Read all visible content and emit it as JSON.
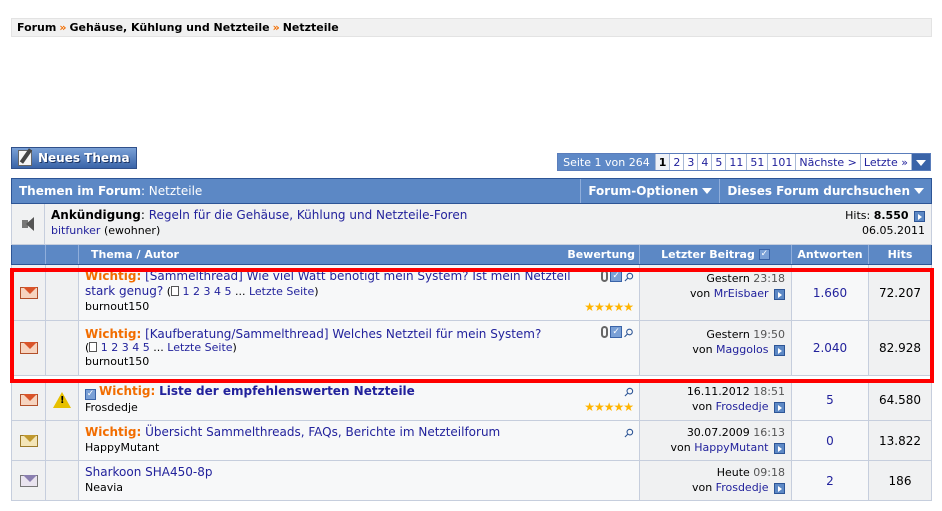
{
  "breadcrumb": {
    "items": [
      "Forum",
      "Gehäuse, Kühlung und Netzteile",
      "Netzteile"
    ],
    "separator": "»"
  },
  "new_thread_button": "Neues Thema",
  "pager": {
    "label": "Seite 1 von 264",
    "pages": [
      "1",
      "2",
      "3",
      "4",
      "5",
      "11",
      "51",
      "101"
    ],
    "current": "1",
    "next": "Nächste >",
    "last": "Letzte »"
  },
  "forum_header": {
    "prefix": "Themen im Forum",
    "name": ": Netzteile",
    "options": "Forum-Optionen",
    "search": "Dieses Forum durchsuchen"
  },
  "announcement": {
    "label": "Ankündigung",
    "title": "Regeln für die Gehäuse, Kühlung und Netzteile-Foren",
    "author": "bitfunker",
    "author_suffix": "(ewohner)",
    "hits_label": "Hits:",
    "hits": "8.550",
    "date": "06.05.2011"
  },
  "columns": {
    "topic": "Thema / Autor",
    "rating": "Bewertung",
    "last_post": "Letzter Beitrag",
    "replies": "Antworten",
    "hits": "Hits"
  },
  "threads": [
    {
      "prefix": "Wichtig:",
      "title": "[Sammelthread] Wie viel Watt benötigt mein System? Ist mein Netzteil stark genug?",
      "pages_open": " (",
      "pages": "1 2 3 4 5",
      "ellipsis": " ... ",
      "last_page": "Letzte Seite",
      "pages_close": ")",
      "author": "burnout150",
      "last_day": "Gestern",
      "last_time": "23:18",
      "by": "von",
      "last_user": "MrEisbaer",
      "replies": "1.660",
      "hits": "72.207",
      "stars": "★★★★★"
    },
    {
      "prefix": "Wichtig:",
      "title": "[Kaufberatung/Sammelthread] Welches Netzteil für mein System?",
      "pages_open": "(",
      "pages": "1 2 3 4 5",
      "ellipsis": " ... ",
      "last_page": "Letzte Seite",
      "pages_close": ")",
      "author": "burnout150",
      "last_day": "Gestern",
      "last_time": "19:50",
      "by": "von",
      "last_user": "Maggolos",
      "replies": "2.040",
      "hits": "82.928"
    },
    {
      "prefix": "Wichtig:",
      "title": "Liste der empfehlenswerten Netzteile",
      "author": "Frosdedje",
      "last_day": "16.11.2012",
      "last_time": "18:51",
      "by": "von",
      "last_user": "Frosdedje",
      "replies": "5",
      "hits": "64.580",
      "stars": "★★★★★"
    },
    {
      "prefix": "Wichtig:",
      "title": "Übersicht Sammelthreads, FAQs, Berichte im Netzteilforum",
      "author": "HappyMutant",
      "last_day": "30.07.2009",
      "last_time": "16:13",
      "by": "von",
      "last_user": "HappyMutant",
      "replies": "0",
      "hits": "13.822"
    },
    {
      "title": "Sharkoon SHA450-8p",
      "author": "Neavia",
      "last_day": "Heute",
      "last_time": "09:18",
      "by": "von",
      "last_user": "Frosdedje",
      "replies": "2",
      "hits": "186"
    }
  ],
  "colors": {
    "header_blue": "#5c88c5",
    "accent_orange": "#f26d00",
    "link": "#22229c",
    "highlight": "#ff0000"
  }
}
